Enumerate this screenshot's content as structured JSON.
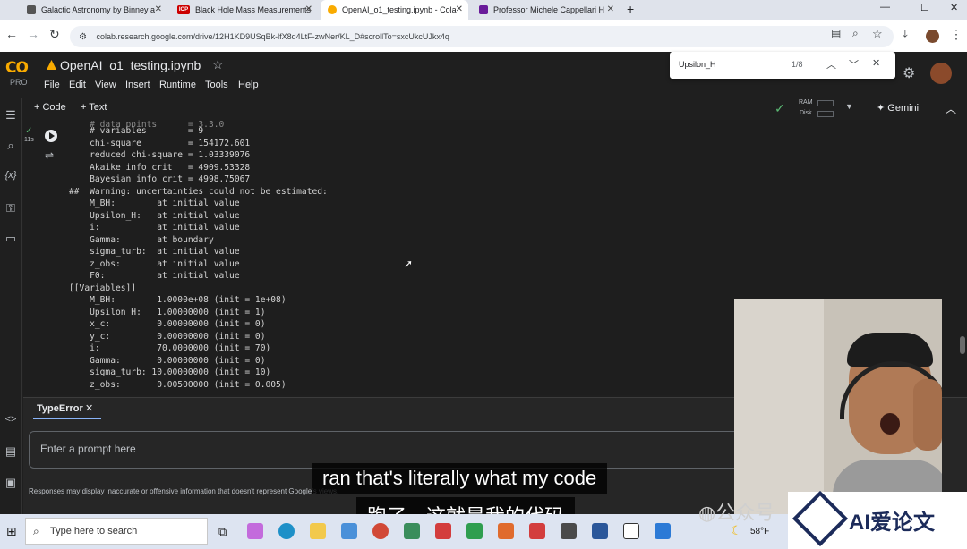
{
  "browser": {
    "tabs": [
      {
        "title": "Galactic Astronomy by Binney a",
        "active": false
      },
      {
        "title": "Black Hole Mass Measurements",
        "active": false
      },
      {
        "title": "OpenAI_o1_testing.ipynb - Cola",
        "active": true
      },
      {
        "title": "Professor Michele Cappellari H",
        "active": false
      }
    ],
    "new_tab": "+",
    "url": "colab.research.google.com/drive/12H1KD9USqBk-lfX8d4LtF-zwNer/KL_D#scrollTo=sxcUkcUJkx4q",
    "iop_badge": "IOP"
  },
  "find_bar": {
    "query": "Upsilon_H",
    "count": "1/8"
  },
  "colab": {
    "logo": "CO",
    "tier": "PRO",
    "notebook_title": "OpenAI_o1_testing.ipynb",
    "menu": [
      "File",
      "Edit",
      "View",
      "Insert",
      "Runtime",
      "Tools",
      "Help"
    ],
    "toolbar": {
      "add_code": "+ Code",
      "add_text": "+ Text",
      "ram_label": "RAM",
      "disk_label": "Disk",
      "gemini_label": "Gemini"
    },
    "cell_time": "11s",
    "output_lines": [
      "    # variables        = 9",
      "    chi-square         = 154172.601",
      "    reduced chi-square = 1.03339076",
      "    Akaike info crit   = 4909.53328",
      "    Bayesian info crit = 4998.75067",
      "##  Warning: uncertainties could not be estimated:",
      "    M_BH:        at initial value",
      "    Upsilon_H:   at initial value",
      "    i:           at initial value",
      "    Gamma:       at boundary",
      "    sigma_turb:  at initial value",
      "    z_obs:       at initial value",
      "    F0:          at initial value",
      "[[Variables]]",
      "    M_BH:        1.0000e+08 (init = 1e+08)",
      "    Upsilon_H:   1.00000000 (init = 1)",
      "    x_c:         0.00000000 (init = 0)",
      "    y_c:         0.00000000 (init = 0)",
      "    i:           70.0000000 (init = 70)",
      "    Gamma:       0.00000000 (init = 0)",
      "    sigma_turb: 10.00000000 (init = 10)",
      "    z_obs:       0.00500000 (init = 0.005)"
    ],
    "panel_tab": "TypeError",
    "prompt_placeholder": "Enter a prompt here",
    "disclaimer": "Responses may display inaccurate or offensive information that doesn't represent Google's views."
  },
  "subtitles": {
    "english": "ran that's literally what my code",
    "chinese": "跑了，这就是我的代码"
  },
  "watermark": {
    "wechat": "公众号",
    "brand": "AI爱论文"
  },
  "taskbar": {
    "search_placeholder": "Type here to search",
    "weather": "58°F"
  },
  "colors": {
    "colab_bg": "#1f1f1f",
    "logo_orange": "#f9ab00",
    "brand_navy": "#1c2b5a"
  }
}
